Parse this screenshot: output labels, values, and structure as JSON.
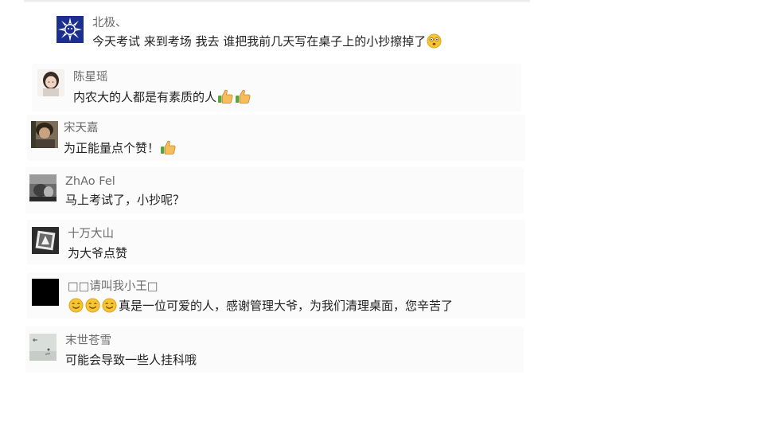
{
  "comments": [
    {
      "name": "北极、",
      "text": "今天考试 来到考场 我去 谁把我前几天写在桌子上的小抄擦掉了"
    },
    {
      "name": "陈星瑶",
      "text": "内农大的人都是有素质的人"
    },
    {
      "name": "宋天嘉",
      "text": "为正能量点个赞！"
    },
    {
      "name": "ZhAo Fel",
      "text": "马上考试了，小抄呢？"
    },
    {
      "name": "十万大山",
      "text": "为大爷点赞"
    },
    {
      "name": "□□请叫我小王□",
      "text": "真是一位可爱的人，感谢管理大爷，为我们清理桌面，您辛苦了"
    },
    {
      "name": "末世苍雪",
      "text": "可能会导致一些人挂科哦"
    }
  ],
  "icons": {
    "thumbs_up": "thumbs-up-icon",
    "smile": "smile-icon",
    "dizzy": "dizzy-face-icon"
  }
}
